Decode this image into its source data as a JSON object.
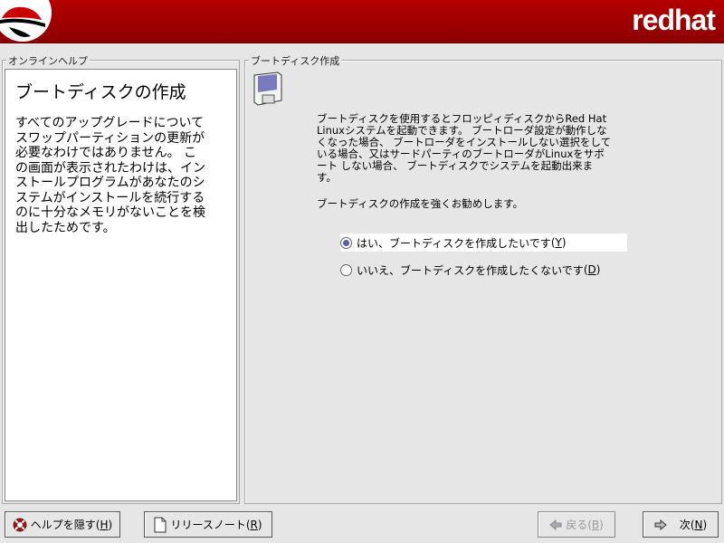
{
  "header": {
    "brand": "redhat"
  },
  "help": {
    "frame_title": "オンラインヘルプ",
    "title": "ブートディスクの作成",
    "lines": [
      "すべてのアップグレードについて",
      "スワップパーティションの更新が",
      "必要なわけではありません。 こ",
      "の画面が表示されたわけは、イン",
      "ストールプログラムがあなたのシ",
      "ステムがインストールを続行する",
      "のに十分なメモリがないことを検",
      "出したためです。"
    ]
  },
  "main": {
    "frame_title": "ブートディスク作成",
    "description": "ブートディスクを使用するとフロッピィディスクからRed Hat\nLinuxシステムを起動できます。 ブートローダ設定が動作しな\nくなった場合、 ブートローダをインストールしない選択をして\nいる場合、又はサードパーティのブートローダがLinuxをサポ\nート しない場合、 ブートディスクでシステムを起動出来ま\nす。",
    "recommend": "ブートディスクの作成を強くお勧めします。",
    "options": [
      {
        "label": "はい、ブートディスクを作成したいです",
        "key": "Y",
        "selected": true
      },
      {
        "label": "いいえ、ブートディスクを作成したくないです",
        "key": "D",
        "selected": false
      }
    ]
  },
  "buttons": {
    "hide_help": {
      "label": "ヘルプを隠す",
      "key": "H"
    },
    "release_notes": {
      "label": "リリースノート",
      "key": "R"
    },
    "back": {
      "label": "戻る",
      "key": "B",
      "enabled": false
    },
    "next": {
      "label": "次",
      "key": "N"
    }
  }
}
